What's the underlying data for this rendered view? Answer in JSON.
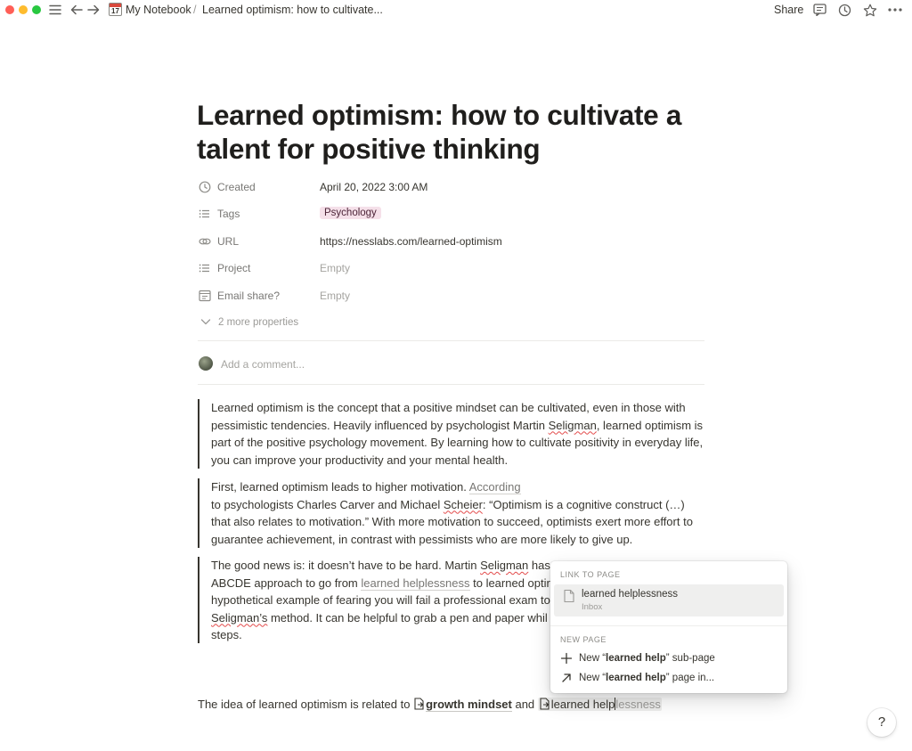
{
  "topbar": {
    "breadcrumb_notebook": "My Notebook",
    "breadcrumb_sep": "/",
    "breadcrumb_page": "Learned optimism: how to cultivate...",
    "notebook_icon_day": "17",
    "share_label": "Share",
    "icons": [
      "menu-icon",
      "back-arrow-icon",
      "forward-arrow-icon",
      "comments-icon",
      "history-icon",
      "favorite-star-icon",
      "more-icon"
    ]
  },
  "page": {
    "title": "Learned optimism: how to cultivate a talent for positive thinking",
    "properties": [
      {
        "icon": "clock-icon",
        "name": "Created",
        "value": "April 20, 2022 3:00 AM"
      },
      {
        "icon": "list-icon",
        "name": "Tags",
        "value": "Psychology"
      },
      {
        "icon": "link-icon",
        "name": "URL",
        "value": "https://nesslabs.com/learned-optimism"
      },
      {
        "icon": "list-icon",
        "name": "Project",
        "value": "Empty"
      },
      {
        "icon": "calendar-icon",
        "name": "Email share?",
        "value": "Empty"
      }
    ],
    "more_properties": "2 more properties",
    "comment_placeholder": "Add a comment...",
    "tag_color": "#f5e0e9"
  },
  "content": {
    "quote1": {
      "a": "Learned optimism is the concept that a positive mindset can be cultivated, even in those with pessimistic tendencies. Heavily influenced by psychologist Martin ",
      "b": "Seligman",
      "c": ", learned optimism is part of the positive psychology movement. By learning how to cultivate positivity in everyday life, you can improve your productivity and your mental health."
    },
    "quote2": {
      "a": "First, learned optimism leads to higher motivation. ",
      "link": "According",
      "b": " to psychologists Charles Carver and Michael ",
      "c": "Scheier",
      "d": ": “Optimism is a cognitive construct (…) that also relates to motivation.” With more motivation to succeed, optimists exert more effort to guarantee achievement, in contrast with pessimists who are more likely to give up."
    },
    "quote3": {
      "a": "The good news is: it doesn’t have to be hard. Martin ",
      "b": "Seligman",
      "c": " has",
      "d": "ABCDE approach to go from ",
      "link": "learned helplessness",
      "e": " to learned optir",
      "f": "hypothetical example of fearing you will fail a professional exam to",
      "g": "Seligman’s",
      "h": " method. It can be helpful to grab a pen and paper whil",
      "i": "steps."
    },
    "bottom": {
      "a": "The idea of learned optimism is related to ",
      "link1": "growth mindset",
      "b": " and ",
      "typed": "learned help",
      "ghost": "lessness"
    }
  },
  "popup": {
    "link_header": "LINK TO PAGE",
    "result_title": "learned helplessness",
    "result_sub": "Inbox",
    "new_header": "NEW PAGE",
    "new_sub_prefix": "New “",
    "new_sub_bold": "learned help",
    "new_sub_suffix": "” sub-page",
    "new_in_prefix": "New “",
    "new_in_bold": "learned help",
    "new_in_suffix": "” page in..."
  },
  "help_label": "?"
}
